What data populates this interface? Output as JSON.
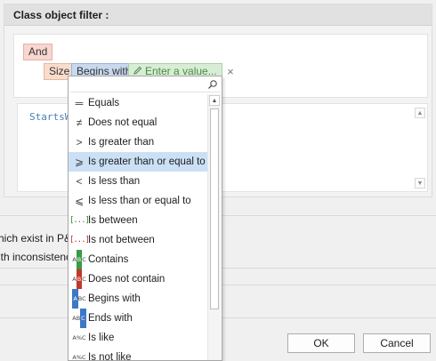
{
  "panel": {
    "title": "Class object filter :"
  },
  "filter": {
    "and_label": "And",
    "field_label": "Size",
    "operator_label": "Begins with",
    "value_placeholder": "Enter a value...",
    "clear_glyph": "×"
  },
  "expression": {
    "text": "StartsW"
  },
  "background_text": {
    "line1": "hich exist in P&",
    "line2": "ith inconsistenc"
  },
  "buttons": {
    "ok": "OK",
    "cancel": "Cancel"
  },
  "dropdown": {
    "search_value": "",
    "items": [
      {
        "label": "Equals",
        "icon": "equals-icon",
        "glyph": "═"
      },
      {
        "label": "Does not equal",
        "icon": "not-equal-icon",
        "glyph": "≠"
      },
      {
        "label": "Is greater than",
        "icon": "greater-than-icon",
        "glyph": ">"
      },
      {
        "label": "Is greater than or equal to",
        "icon": "greater-equal-icon",
        "glyph": "⩾"
      },
      {
        "label": "Is less than",
        "icon": "less-than-icon",
        "glyph": "<"
      },
      {
        "label": "Is less than or equal to",
        "icon": "less-equal-icon",
        "glyph": "⩽"
      },
      {
        "label": "Is between",
        "icon": "between-icon",
        "glyph": "[...]"
      },
      {
        "label": "Is not between",
        "icon": "not-between-icon",
        "glyph": "[...]"
      },
      {
        "label": "Contains",
        "icon": "contains-icon",
        "glyph": "ABC"
      },
      {
        "label": "Does not contain",
        "icon": "not-contains-icon",
        "glyph": "ABC"
      },
      {
        "label": "Begins with",
        "icon": "begins-with-icon",
        "glyph": "ABC"
      },
      {
        "label": "Ends with",
        "icon": "ends-with-icon",
        "glyph": "ABC"
      },
      {
        "label": "Is like",
        "icon": "is-like-icon",
        "glyph": "A%C"
      },
      {
        "label": "Is not like",
        "icon": "not-like-icon",
        "glyph": "A%C"
      }
    ],
    "selected_index": 3
  },
  "colors": {
    "selected_bg": "#cce0f5",
    "and_chip": "#f9d6d0",
    "field_chip": "#f8dccc",
    "operator_chip": "#c9d9ee",
    "value_chip": "#d8edd6"
  }
}
